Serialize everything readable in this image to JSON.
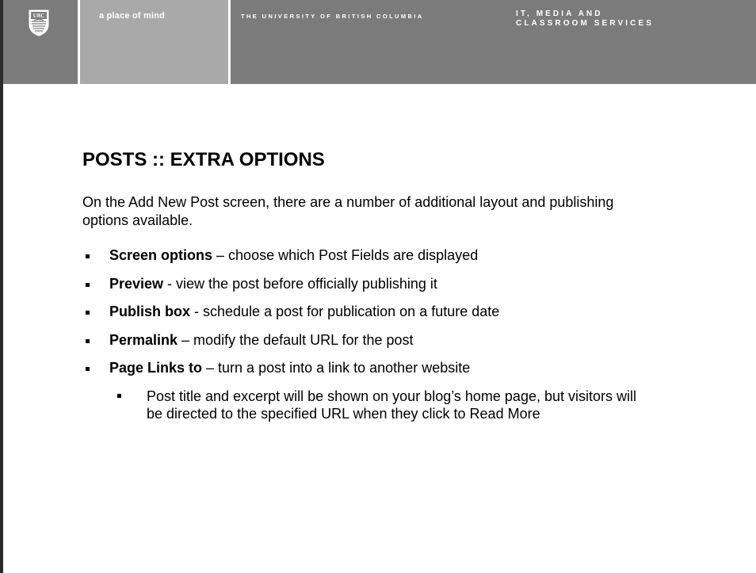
{
  "header": {
    "logo_text": "UBC",
    "tagline": "a place of mind",
    "university": "THE UNIVERSITY OF BRITISH COLUMBIA",
    "unit_line_1": "IT, MEDIA AND",
    "unit_line_2": "CLASSROOM SERVICES"
  },
  "slide": {
    "title": "POSTS :: EXTRA OPTIONS",
    "intro": "On the Add New Post screen, there are a number of additional layout and publishing options available.",
    "bullets": [
      {
        "term": "Screen options",
        "text": " – choose which Post Fields are displayed"
      },
      {
        "term": "Preview",
        "text": " - view the post before officially publishing it"
      },
      {
        "term": "Publish box",
        "text": " - schedule a post for publication on a future date"
      },
      {
        "term": "Permalink",
        "text": " – modify the default URL for the post"
      },
      {
        "term": "Page Links to",
        "text": " – turn a post into a link to another website"
      }
    ],
    "sub_bullet": "Post title and excerpt will be shown on your blog’s home page, but visitors will be directed to the specified URL when they click to Read More"
  },
  "colors": {
    "header_dark": "#7b7b7b",
    "header_light": "#a9a9a9",
    "text": "#000000"
  }
}
